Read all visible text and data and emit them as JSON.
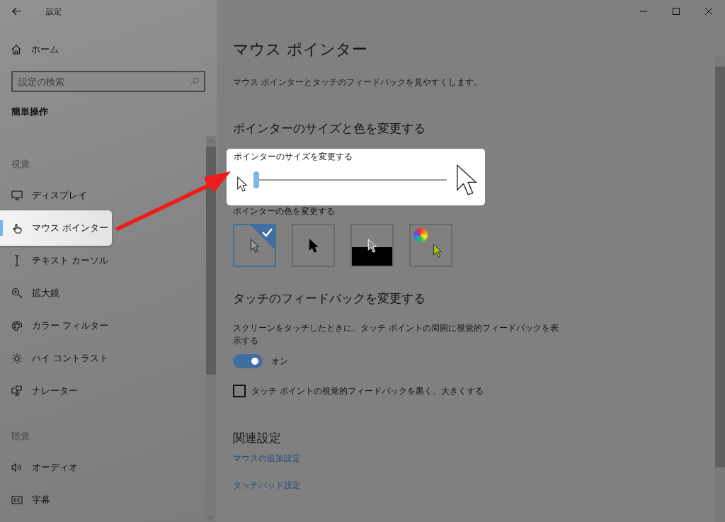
{
  "window": {
    "title": "設定"
  },
  "sidebar": {
    "home": "ホーム",
    "search": {
      "placeholder": "設定の検索"
    },
    "category": "簡単操作",
    "groups": [
      {
        "heading": "視覚",
        "items": [
          {
            "label": "ディスプレイ",
            "selected": false
          },
          {
            "label": "マウス ポインター",
            "selected": true
          },
          {
            "label": "テキスト カーソル",
            "selected": false
          },
          {
            "label": "拡大鏡",
            "selected": false
          },
          {
            "label": "カラー フィルター",
            "selected": false
          },
          {
            "label": "ハイ コントラスト",
            "selected": false
          },
          {
            "label": "ナレーター",
            "selected": false
          }
        ]
      },
      {
        "heading": "聴覚",
        "items": [
          {
            "label": "オーディオ",
            "selected": false
          },
          {
            "label": "字幕",
            "selected": false
          }
        ]
      }
    ]
  },
  "main": {
    "title": "マウス ポインター",
    "description": "マウス ポインターとタッチのフィードバックを見やすくします。",
    "pointer_section": {
      "heading": "ポインターのサイズと色を変更する",
      "size_slider": {
        "label": "ポインターのサイズを変更する",
        "level": 0
      },
      "color": {
        "label": "ポインターの色を変更する",
        "options": [
          {
            "kind": "standard",
            "selected": true
          },
          {
            "kind": "black",
            "selected": false
          },
          {
            "kind": "inverted",
            "selected": false
          },
          {
            "kind": "custom",
            "selected": false
          }
        ]
      }
    },
    "touch_section": {
      "heading": "タッチのフィードバックを変更する",
      "description": "スクリーンをタッチしたときに、タッチ ポイントの周囲に視覚的フィードバックを表示する",
      "toggle": {
        "on": true,
        "label": "オン"
      },
      "checkbox": {
        "label": "タッチ ポイントの視覚的フィードバックを黒く、大きくする",
        "checked": false
      }
    },
    "related": {
      "heading": "関連設定",
      "links": [
        "マウスの追加設定",
        "タッチパッド設定"
      ]
    }
  }
}
